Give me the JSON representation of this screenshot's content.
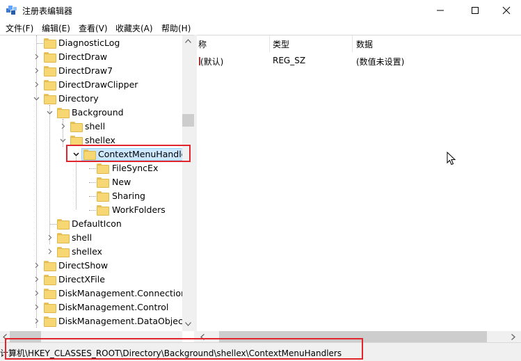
{
  "window": {
    "title": "注册表编辑器",
    "icon": "registry-editor-icon"
  },
  "menu": [
    "文件(F)",
    "编辑(E)",
    "查看(V)",
    "收藏夹(A)",
    "帮助(H)"
  ],
  "tree": [
    {
      "label": "DiagnosticLog",
      "indent": 0,
      "expander": "none"
    },
    {
      "label": "DirectDraw",
      "indent": 0,
      "expander": "collapsed"
    },
    {
      "label": "DirectDraw7",
      "indent": 0,
      "expander": "collapsed"
    },
    {
      "label": "DirectDrawClipper",
      "indent": 0,
      "expander": "collapsed"
    },
    {
      "label": "Directory",
      "indent": 0,
      "expander": "expanded"
    },
    {
      "label": "Background",
      "indent": 1,
      "expander": "expanded"
    },
    {
      "label": "shell",
      "indent": 2,
      "expander": "collapsed"
    },
    {
      "label": "shellex",
      "indent": 2,
      "expander": "expanded"
    },
    {
      "label": "ContextMenuHandle",
      "indent": 3,
      "expander": "expanded",
      "selected": true
    },
    {
      "label": "FileSyncEx",
      "indent": 4,
      "expander": "none"
    },
    {
      "label": "New",
      "indent": 4,
      "expander": "none"
    },
    {
      "label": "Sharing",
      "indent": 4,
      "expander": "none"
    },
    {
      "label": "WorkFolders",
      "indent": 4,
      "expander": "none"
    },
    {
      "label": "DefaultIcon",
      "indent": 1,
      "expander": "none"
    },
    {
      "label": "shell",
      "indent": 1,
      "expander": "collapsed"
    },
    {
      "label": "shellex",
      "indent": 1,
      "expander": "collapsed"
    },
    {
      "label": "DirectShow",
      "indent": 0,
      "expander": "collapsed"
    },
    {
      "label": "DirectXFile",
      "indent": 0,
      "expander": "collapsed"
    },
    {
      "label": "DiskManagement.Connection",
      "indent": 0,
      "expander": "collapsed"
    },
    {
      "label": "DiskManagement.Control",
      "indent": 0,
      "expander": "collapsed"
    },
    {
      "label": "DiskManagement.DataObject",
      "indent": 0,
      "expander": "collapsed"
    }
  ],
  "list": {
    "columns": [
      "称",
      "类型",
      "数据"
    ],
    "rows": [
      {
        "name": "(默认)",
        "type": "REG_SZ",
        "data": "(数值未设置)"
      }
    ]
  },
  "status": {
    "path": "计算机\\HKEY_CLASSES_ROOT\\Directory\\Background\\shellex\\ContextMenuHandlers",
    "path_visible": "计算机\\HKEY_CLASSES_ROOT\\Directory\\Background\\shellex\\ContextMenuHandlers"
  },
  "colors": {
    "highlight": "#e0262c",
    "selection": "#cce8ff"
  }
}
